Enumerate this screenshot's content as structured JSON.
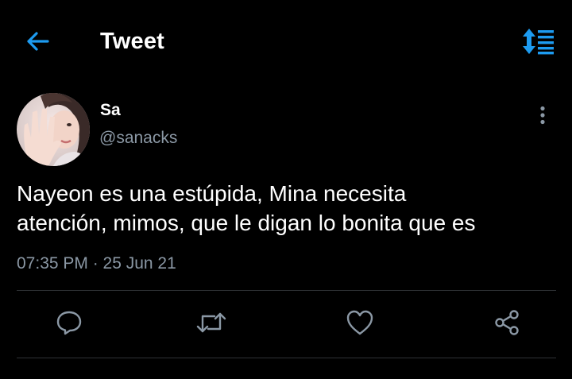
{
  "header": {
    "title": "Tweet",
    "back_icon": "arrow-left-icon",
    "sort_icon": "sort-list-icon",
    "accent_color": "#1d9bf0"
  },
  "tweet": {
    "author_name": "Sa",
    "author_handle": "@sanacks",
    "text_line_1": "Nayeon es una estúpida, Mina necesita",
    "text_line_2": "atención, mimos, que le digan lo bonita que es",
    "timestamp": "07:35 PM · 25 Jun 21"
  },
  "actions": [
    {
      "icon": "reply-icon"
    },
    {
      "icon": "retweet-icon"
    },
    {
      "icon": "like-icon"
    },
    {
      "icon": "share-icon"
    }
  ],
  "colors": {
    "background": "#000000",
    "text": "#ffffff",
    "secondary_text": "#8b98a5",
    "divider": "#2f3336",
    "icon": "#8b98a5"
  }
}
